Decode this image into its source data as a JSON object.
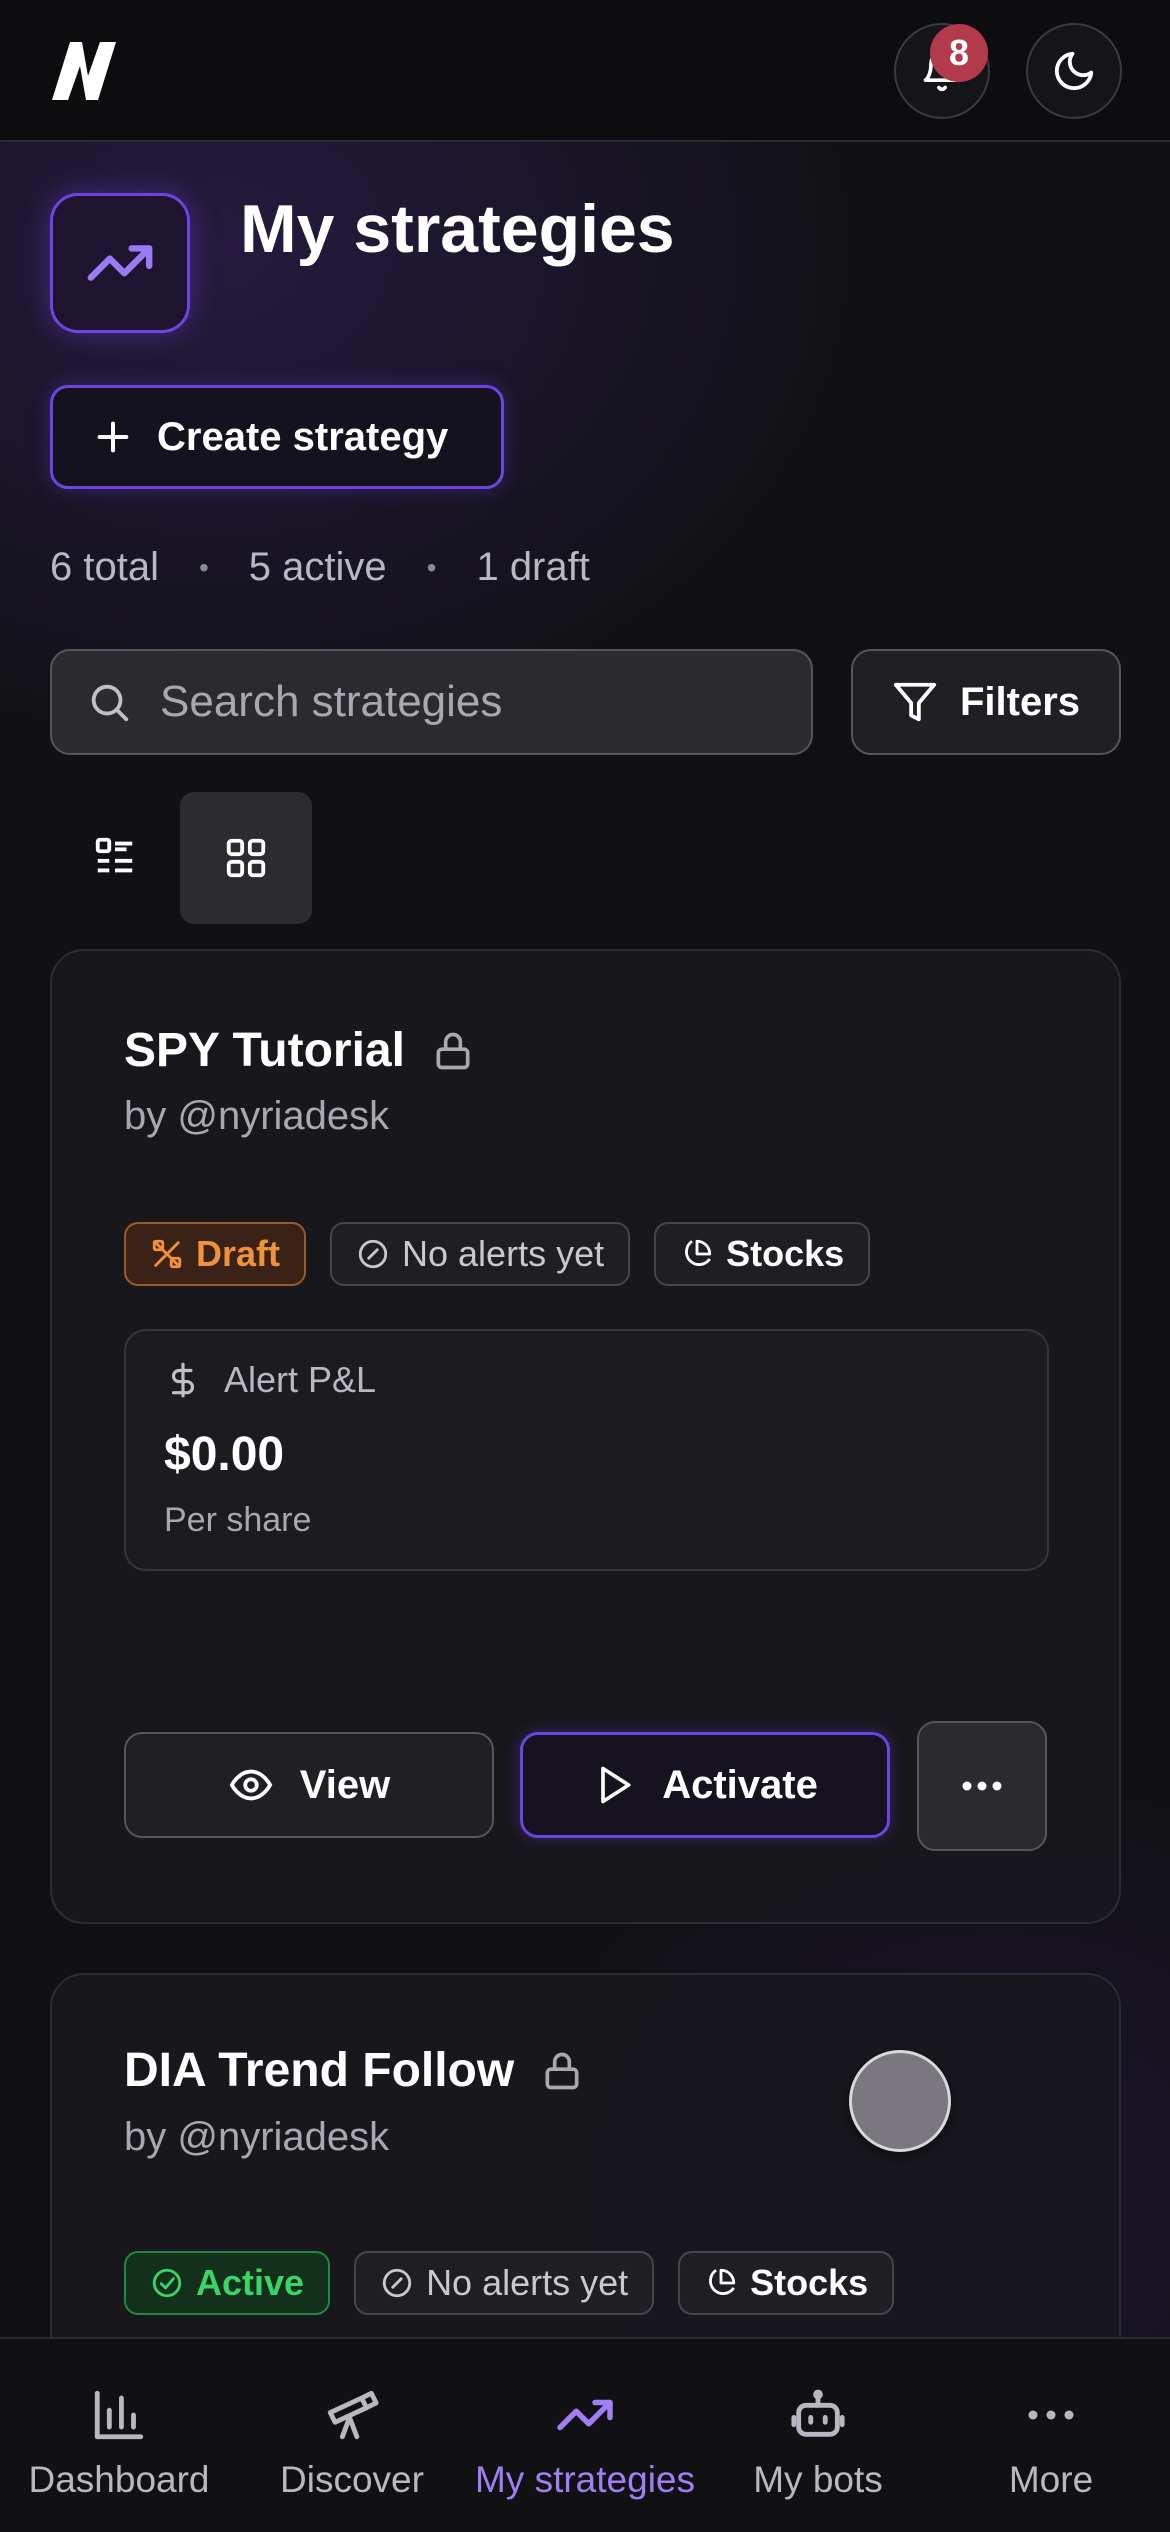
{
  "header": {
    "notifications_count": "8"
  },
  "page": {
    "title": "My strategies",
    "create_label": "Create strategy",
    "summary": {
      "total": "6 total",
      "active": "5 active",
      "draft": "1 draft"
    },
    "separator": "•",
    "search_placeholder": "Search strategies",
    "filters_label": "Filters"
  },
  "cards": [
    {
      "title": "SPY Tutorial",
      "author": "by @nyriadesk",
      "status": "Draft",
      "alerts": "No alerts yet",
      "market": "Stocks",
      "pnl_label": "Alert P&L",
      "pnl_value": "$0.00",
      "pnl_unit": "Per share",
      "view_label": "View",
      "activate_label": "Activate"
    },
    {
      "title": "DIA Trend Follow",
      "author": "by @nyriadesk",
      "status": "Active",
      "alerts": "No alerts yet",
      "market": "Stocks"
    }
  ],
  "nav": [
    {
      "label": "Dashboard",
      "icon": "bar-chart-icon"
    },
    {
      "label": "Discover",
      "icon": "telescope-icon"
    },
    {
      "label": "My strategies",
      "icon": "trending-up-icon",
      "active": true
    },
    {
      "label": "My bots",
      "icon": "bot-icon"
    },
    {
      "label": "More",
      "icon": "more-horizontal-icon"
    }
  ],
  "colors": {
    "accent": "#6b45e0",
    "accent_text": "#a07ef6",
    "draft": "#f0923a",
    "active": "#3ad467",
    "badge": "#b33a4a"
  }
}
